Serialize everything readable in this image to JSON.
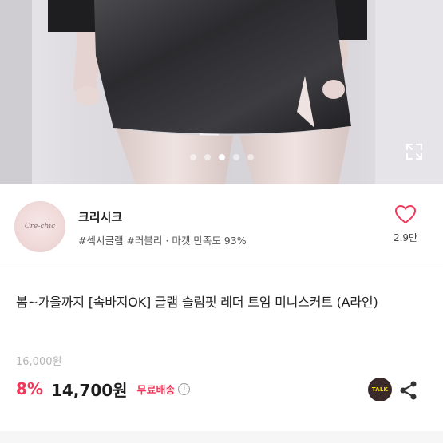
{
  "hero": {
    "slide_count": 5,
    "active_slide": 3
  },
  "seller": {
    "avatar_text": "Cre-chic",
    "name": "크리시크",
    "tags": "#섹시글램 #러블리 · 마켓 만족도 93%",
    "like_count": "2.9만"
  },
  "product": {
    "title": "봄~가을까지 [속바지OK] 글램 슬림핏 레더 트임 미니스커트 (A라인)",
    "original_price": "16,000원",
    "discount": "8%",
    "price": "14,700원",
    "shipping": "무료배송",
    "info_icon": "i"
  },
  "actions": {
    "talk_label": "TALK",
    "share_icon": "share-icon"
  },
  "colors": {
    "accent": "#f2385a",
    "talk_bg": "#3a2929",
    "talk_text": "#f7e000"
  }
}
